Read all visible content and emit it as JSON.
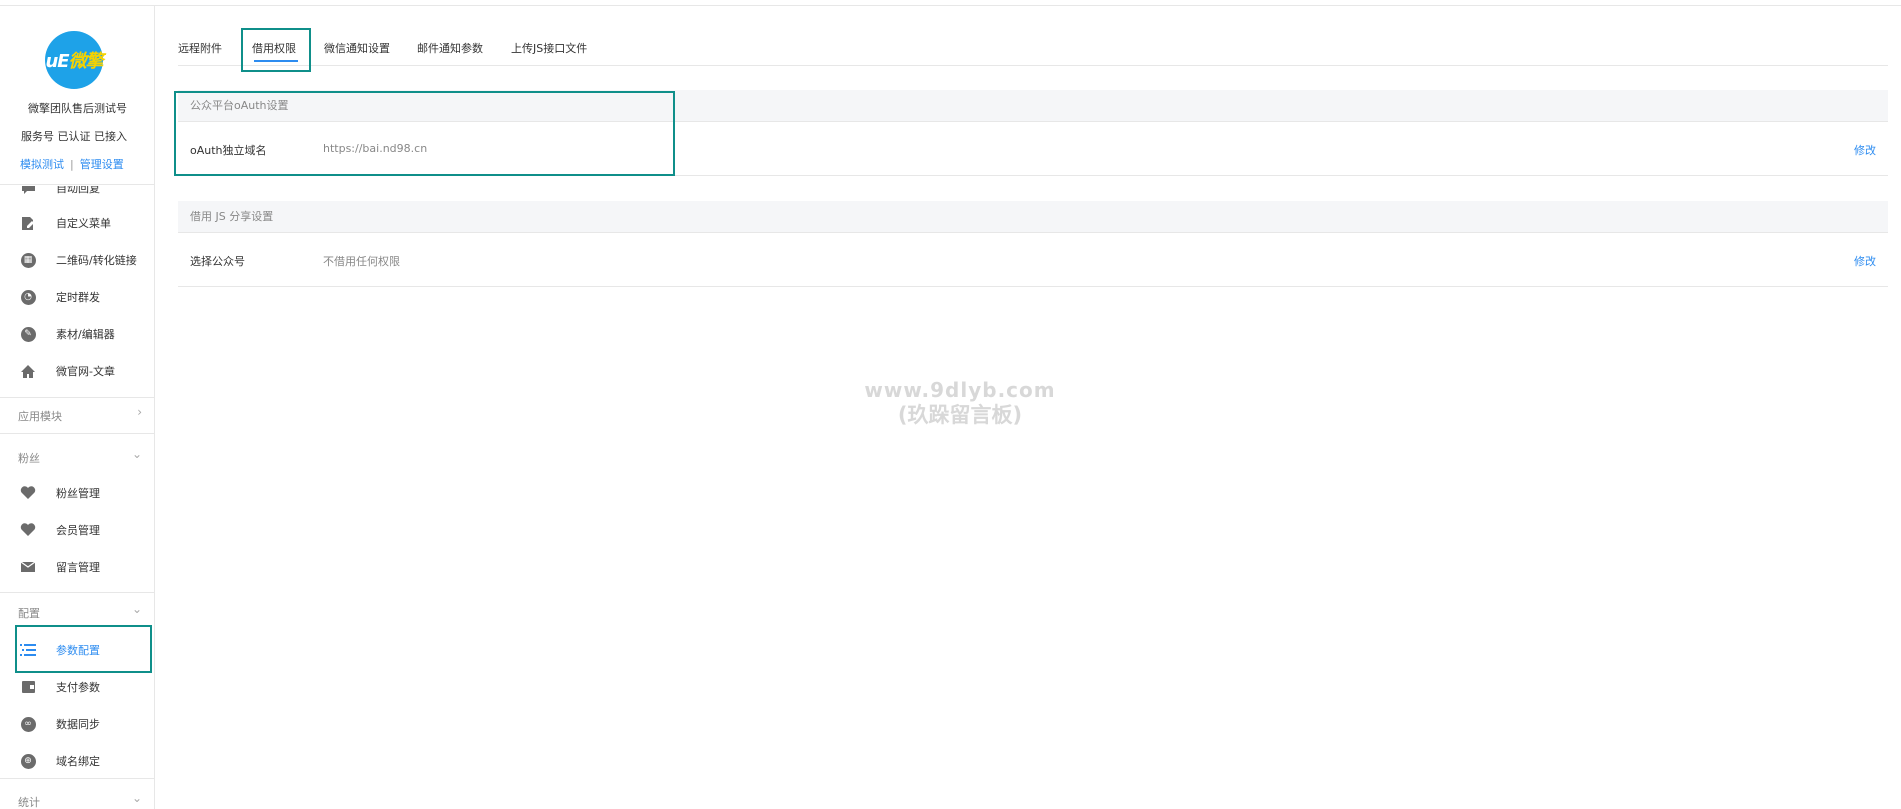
{
  "account": {
    "logo_text_a": "uE",
    "logo_text_b": "微擎",
    "name": "微擎团队售后测试号",
    "type_status": "服务号 已认证 已接入",
    "link_simulate": "模拟测试",
    "link_separator": "|",
    "link_manage": "管理设置"
  },
  "sidebar": {
    "items_top": [
      {
        "label": "自动回复",
        "icon": "chat-bubble-icon"
      },
      {
        "label": "自定义菜单",
        "icon": "document-edit-icon"
      },
      {
        "label": "二维码/转化链接",
        "icon": "qrcode-circle-icon"
      },
      {
        "label": "定时群发",
        "icon": "clock-user-icon"
      },
      {
        "label": "素材/编辑器",
        "icon": "pencil-circle-icon"
      },
      {
        "label": "微官网-文章",
        "icon": "home-icon"
      }
    ],
    "group_apps": {
      "label": "应用模块",
      "chevron": "›"
    },
    "group_fans": {
      "label": "粉丝",
      "chevron": "⌄"
    },
    "items_fans": [
      {
        "label": "粉丝管理",
        "icon": "heart-check-icon"
      },
      {
        "label": "会员管理",
        "icon": "heart-icon"
      },
      {
        "label": "留言管理",
        "icon": "envelope-icon"
      }
    ],
    "group_config": {
      "label": "配置",
      "chevron": "⌄"
    },
    "items_config": [
      {
        "label": "参数配置",
        "icon": "list-lines-icon",
        "active": true
      },
      {
        "label": "支付参数",
        "icon": "wallet-icon"
      },
      {
        "label": "数据同步",
        "icon": "link-circle-icon"
      },
      {
        "label": "域名绑定",
        "icon": "globe-circle-icon"
      }
    ],
    "group_stats": {
      "label": "统计",
      "chevron": "⌄"
    }
  },
  "tabs": [
    {
      "label": "远程附件"
    },
    {
      "label": "借用权限",
      "active": true
    },
    {
      "label": "微信通知设置"
    },
    {
      "label": "邮件通知参数"
    },
    {
      "label": "上传JS接口文件"
    }
  ],
  "oauth_panel": {
    "title": "公众平台oAuth设置",
    "row_label": "oAuth独立域名",
    "row_value": "https://bai.nd98.cn",
    "action": "修改"
  },
  "js_panel": {
    "title": "借用 JS 分享设置",
    "row_label": "选择公众号",
    "row_value": "不借用任何权限",
    "action": "修改"
  },
  "watermark": {
    "line1": "www.9dlyb.com",
    "line2": "(玖跺留言板)"
  },
  "colors": {
    "accent": "#2d8cf0",
    "highlight_box": "#0f8f8a",
    "logo_bg": "#1ea2e8"
  }
}
